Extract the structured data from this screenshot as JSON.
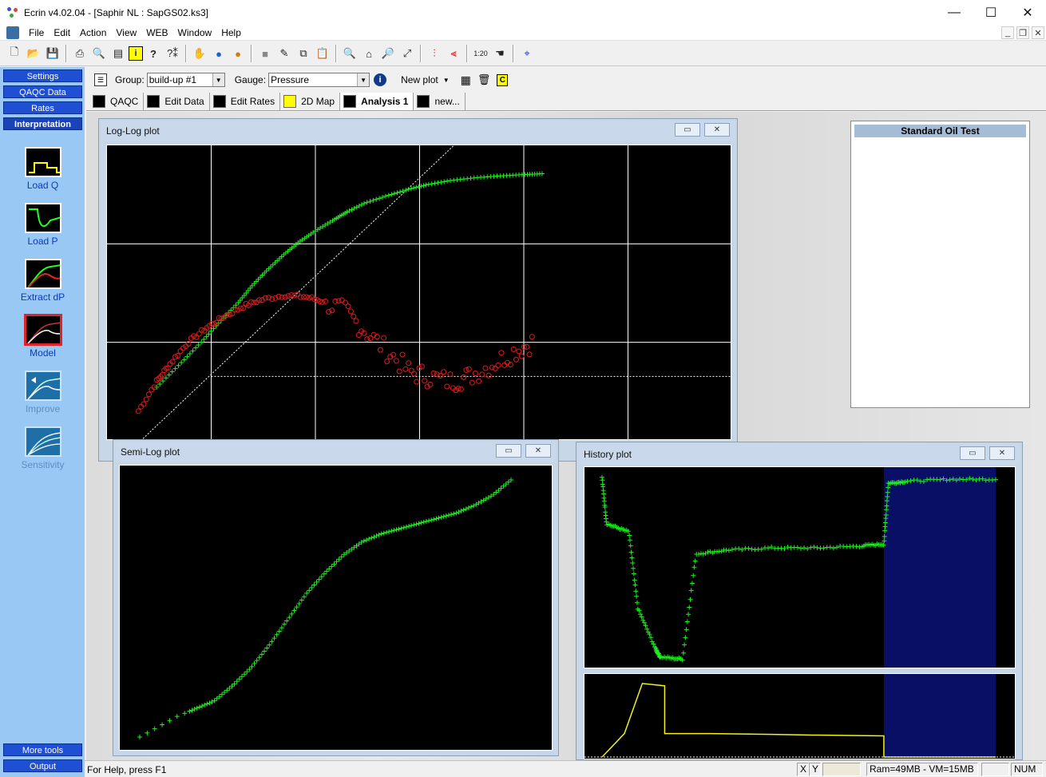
{
  "window": {
    "title": "Ecrin  v4.02.04 - [Saphir NL : SapGS02.ks3]",
    "controls": {
      "minimize": "—",
      "maximize": "☐",
      "close": "✕"
    }
  },
  "menu": [
    "File",
    "Edit",
    "Action",
    "View",
    "WEB",
    "Window",
    "Help"
  ],
  "toolbar_icons": [
    "new-icon",
    "open-icon",
    "save-icon",
    "print-icon",
    "print-preview-icon",
    "page-icon",
    "info-icon",
    "help-icon",
    "context-help-icon",
    "hand-icon",
    "water-drop-icon",
    "oil-drop-icon",
    "stop-icon",
    "edit-icon",
    "copy-icon",
    "paste-icon",
    "zoom-out-icon",
    "zoom-home-icon",
    "zoom-in-icon",
    "zoom-fit-icon",
    "analysis-icon",
    "analysis2-icon",
    "scale-icon",
    "pan-icon",
    "crosshair-icon"
  ],
  "left_panel": {
    "top_buttons": [
      "Settings",
      "QAQC Data",
      "Rates",
      "Interpretation"
    ],
    "active_button": "Interpretation",
    "tools": [
      {
        "label": "Load Q",
        "enabled": true
      },
      {
        "label": "Load P",
        "enabled": true
      },
      {
        "label": "Extract dP",
        "enabled": true
      },
      {
        "label": "Model",
        "enabled": true,
        "selected": true
      },
      {
        "label": "Improve",
        "enabled": false
      },
      {
        "label": "Sensitivity",
        "enabled": false
      }
    ],
    "bottom_buttons": [
      "More tools",
      "Output"
    ]
  },
  "analysis_bar": {
    "group_label": "Group:",
    "group_value": "build-up #1",
    "gauge_label": "Gauge:",
    "gauge_value": "Pressure",
    "new_plot_label": "New plot",
    "c_button": "C"
  },
  "tabs": [
    {
      "label": "QAQC",
      "active": false
    },
    {
      "label": "Edit Data",
      "active": false
    },
    {
      "label": "Edit Rates",
      "active": false
    },
    {
      "label": "2D Map",
      "active": false
    },
    {
      "label": "Analysis 1",
      "active": true
    },
    {
      "label": "new...",
      "active": false
    }
  ],
  "windows": {
    "loglog": {
      "title": "Log-Log plot"
    },
    "semilog": {
      "title": "Semi-Log plot"
    },
    "history": {
      "title": "History plot"
    },
    "standard": {
      "title": "Standard Oil Test"
    }
  },
  "chart_data": [
    {
      "type": "scatter",
      "title": "Log-Log plot",
      "grid": true,
      "series": [
        {
          "name": "",
          "color": "#22ee22",
          "marker": "plus",
          "x": [
            0.03,
            0.05,
            0.08,
            0.12,
            0.18,
            0.25,
            0.35,
            0.5,
            0.7,
            1,
            1.5,
            2,
            3,
            5,
            8,
            12,
            20,
            35,
            60,
            100,
            150
          ],
          "y": [
            0.035,
            0.06,
            0.1,
            0.16,
            0.25,
            0.38,
            0.55,
            0.78,
            1.05,
            1.35,
            1.75,
            2.1,
            2.6,
            3.1,
            3.6,
            4.0,
            4.4,
            4.7,
            4.9,
            5.05,
            5.15
          ]
        },
        {
          "name": "",
          "color": "#e01b1b",
          "marker": "circle",
          "x": [
            0.02,
            0.03,
            0.04,
            0.06,
            0.09,
            0.13,
            0.2,
            0.3,
            0.5,
            0.8,
            1.2,
            2,
            3,
            5,
            8,
            12,
            20,
            30,
            50,
            80,
            120
          ],
          "y": [
            0.02,
            0.04,
            0.06,
            0.1,
            0.14,
            0.18,
            0.23,
            0.27,
            0.3,
            0.29,
            0.26,
            0.2,
            0.13,
            0.08,
            0.05,
            0.045,
            0.04,
            0.045,
            0.06,
            0.08,
            0.1
          ]
        }
      ],
      "unit_slope_line": true,
      "stabilization_line_y": 0.045
    },
    {
      "type": "scatter",
      "title": "Semi-Log plot",
      "series": [
        {
          "name": "",
          "color": "#22ee22",
          "marker": "plus",
          "x": [
            0,
            0.05,
            0.1,
            0.15,
            0.2,
            0.25,
            0.3,
            0.35,
            0.4,
            0.45,
            0.5,
            0.55,
            0.6,
            0.65,
            0.7,
            0.75,
            0.8,
            0.85,
            0.9,
            0.95,
            1
          ],
          "y": [
            0,
            0.04,
            0.08,
            0.11,
            0.14,
            0.2,
            0.27,
            0.36,
            0.46,
            0.56,
            0.64,
            0.71,
            0.76,
            0.79,
            0.81,
            0.83,
            0.85,
            0.87,
            0.9,
            0.94,
            1
          ]
        }
      ]
    },
    {
      "type": "scatter",
      "title": "History plot",
      "series": [
        {
          "name": "",
          "color": "#22ee22",
          "marker": "plus",
          "x": [
            0.12,
            0.13,
            0.18,
            0.2,
            0.24,
            0.25,
            0.3,
            0.33,
            0.4,
            0.5,
            0.6,
            0.7,
            0.75,
            0.76,
            0.8,
            0.9,
            1
          ],
          "y": [
            0.95,
            0.72,
            0.68,
            0.3,
            0.1,
            0.06,
            0.05,
            0.57,
            0.59,
            0.6,
            0.6,
            0.61,
            0.62,
            0.92,
            0.93,
            0.94,
            0.94
          ]
        }
      ],
      "highlight_region_x": [
        0.75,
        1
      ],
      "rate_series": {
        "color": "#f2f21a",
        "x": [
          0.12,
          0.17,
          0.17,
          0.21,
          0.21,
          0.26,
          0.26,
          0.36,
          0.36,
          0.5,
          0.5,
          0.6,
          0.6,
          0.75,
          0.75,
          1
        ],
        "y": [
          0.0,
          0.3,
          0.3,
          0.94,
          0.94,
          0.91,
          0.3,
          0.3,
          0.3,
          0.29,
          0.29,
          0.28,
          0.28,
          0.27,
          0.0,
          0.0
        ]
      }
    }
  ],
  "status": {
    "help_text": "For Help, press F1",
    "x_label": "X",
    "y_label": "Y",
    "memory": "Ram=49MB - VM=15MB",
    "num": "NUM"
  }
}
